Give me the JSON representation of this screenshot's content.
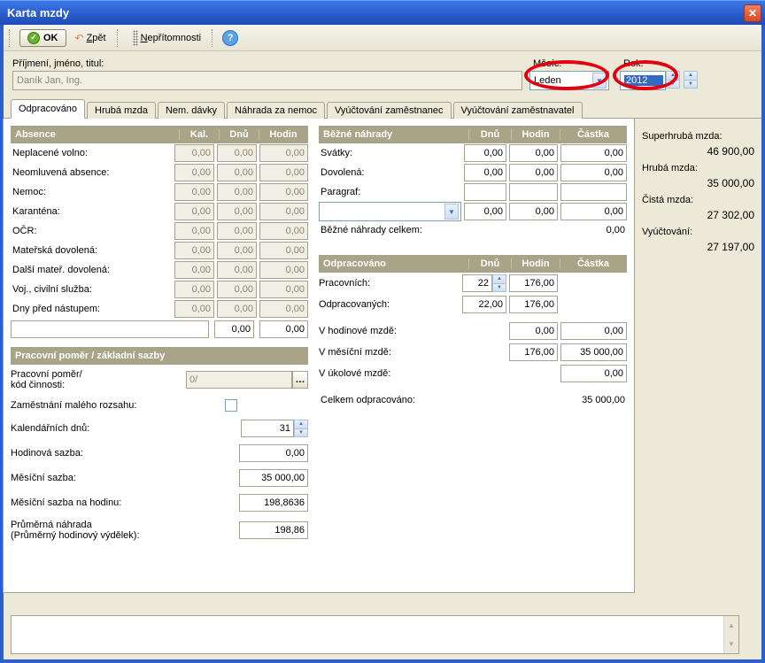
{
  "window": {
    "title": "Karta mzdy"
  },
  "toolbar": {
    "ok": "OK",
    "back": "Zpět",
    "absence": "Nepřítomnosti"
  },
  "header": {
    "name_label": "Příjmení, jméno, titul:",
    "name_value": "Daník Jan, Ing.",
    "mesic_label": "Měsíc:",
    "mesic_value": "Leden",
    "rok_label": "Rok:",
    "rok_value": "2012"
  },
  "tabs": [
    "Odpracováno",
    "Hrubá mzda",
    "Nem. dávky",
    "Náhrada za nemoc",
    "Vyúčtování zaměstnanec",
    "Vyúčtování zaměstnavatel"
  ],
  "absence_section": {
    "title": "Absence",
    "cols": {
      "kal": "Kal.",
      "dnu": "Dnů",
      "hodin": "Hodin"
    },
    "rows": [
      {
        "label": "Neplacené volno:",
        "kal": "0,00",
        "dnu": "0,00",
        "hodin": "0,00"
      },
      {
        "label": "Neomluvená absence:",
        "kal": "0,00",
        "dnu": "0,00",
        "hodin": "0,00"
      },
      {
        "label": "Nemoc:",
        "kal": "0,00",
        "dnu": "0,00",
        "hodin": "0,00"
      },
      {
        "label": "Karanténa:",
        "kal": "0,00",
        "dnu": "0,00",
        "hodin": "0,00"
      },
      {
        "label": "OČR:",
        "kal": "0,00",
        "dnu": "0,00",
        "hodin": "0,00"
      },
      {
        "label": "Mateřská dovolená:",
        "kal": "0,00",
        "dnu": "0,00",
        "hodin": "0,00"
      },
      {
        "label": "Další mateř. dovolená:",
        "kal": "0,00",
        "dnu": "0,00",
        "hodin": "0,00"
      },
      {
        "label": "Voj., civilní služba:",
        "kal": "0,00",
        "dnu": "0,00",
        "hodin": "0,00"
      },
      {
        "label": "Dny před nástupem:",
        "kal": "0,00",
        "dnu": "0,00",
        "hodin": "0,00"
      }
    ],
    "extra": {
      "dnu": "0,00",
      "hodin": "0,00"
    }
  },
  "pomer_section": {
    "title": "Pracovní poměr / základní sazby",
    "pomer_label": "Pracovní poměr/\nkód činnosti:",
    "pomer_value": "0/",
    "zam_label": "Zaměstnání malého rozsahu:",
    "rows": [
      {
        "label": "Kalendářních dnů:",
        "val": "31",
        "spinner": true
      },
      {
        "label": "Hodinová sazba:",
        "val": "0,00"
      },
      {
        "label": "Měsíční sazba:",
        "val": "35 000,00"
      },
      {
        "label": "Měsíční sazba na hodinu:",
        "val": "198,8636"
      },
      {
        "label": "Průměrná náhrada\n(Průměrný hodinový výdělek):",
        "val": "198,86"
      }
    ]
  },
  "bezne_section": {
    "title": "Běžné náhrady",
    "cols": {
      "dnu": "Dnů",
      "hodin": "Hodin",
      "castka": "Částka"
    },
    "rows": [
      {
        "label": "Svátky:",
        "dnu": "0,00",
        "hodin": "0,00",
        "castka": "0,00"
      },
      {
        "label": "Dovolená:",
        "dnu": "0,00",
        "hodin": "0,00",
        "castka": "0,00"
      },
      {
        "label": "Paragraf:",
        "dnu": "",
        "hodin": "",
        "castka": ""
      }
    ],
    "paragraf_row": {
      "dnu": "0,00",
      "hodin": "0,00",
      "castka": "0,00"
    },
    "sum_label": "Běžné náhrady celkem:",
    "sum_value": "0,00"
  },
  "odprac_section": {
    "title": "Odpracováno",
    "cols": {
      "dnu": "Dnů",
      "hodin": "Hodin",
      "castka": "Částka"
    },
    "prac": {
      "label": "Pracovních:",
      "dnu": "22",
      "hodin": "176,00"
    },
    "odpr": {
      "label": "Odpracovaných:",
      "dnu": "22,00",
      "hodin": "176,00"
    },
    "hod": {
      "label": "V hodinové mzdě:",
      "hodin": "0,00",
      "castka": "0,00"
    },
    "mes": {
      "label": "V měsíční mzdě:",
      "hodin": "176,00",
      "castka": "35 000,00"
    },
    "ukol": {
      "label": "V úkolové mzdě:",
      "castka": "0,00"
    },
    "sum_label": "Celkem odpracováno:",
    "sum_value": "35 000,00"
  },
  "summary": {
    "sh_label": "Superhrubá mzda:",
    "sh_val": "46 900,00",
    "hm_label": "Hrubá mzda:",
    "hm_val": "35 000,00",
    "cm_label": "Čistá mzda:",
    "cm_val": "27 302,00",
    "vy_label": "Vyúčtování:",
    "vy_val": "27 197,00"
  }
}
